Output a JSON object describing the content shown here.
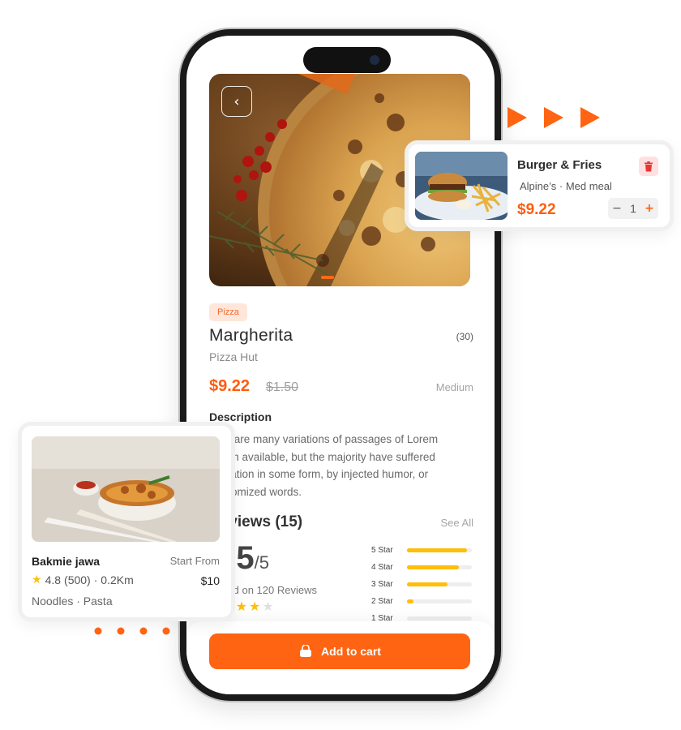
{
  "product": {
    "tag": "Pizza",
    "name": "Margherita",
    "count": "(30)",
    "brand": "Pizza Hut",
    "price": "$9.22",
    "old_price": "$1.50",
    "size": "Medium",
    "description_title": "Description",
    "description": "here are many variations of passages of Lorem Ipsum available, but the majority have suffered alteration in some form, by injected humor, or randomized words."
  },
  "reviews": {
    "title": "Reviews (15)",
    "see_all": "See All",
    "rating": "4.5",
    "rating_max": "/5",
    "based_on": "Based on 120 Reviews",
    "stars_filled": 4,
    "stars_total": 5,
    "breakdown": [
      {
        "label": "5 Star",
        "fraction": 0.93
      },
      {
        "label": "4 Star",
        "fraction": 0.8
      },
      {
        "label": "3 Star",
        "fraction": 0.62
      },
      {
        "label": "2 Star",
        "fraction": 0.1
      },
      {
        "label": "1 Star",
        "fraction": 0.0
      }
    ]
  },
  "cart": {
    "label": "Add to cart",
    "icon": "shopping-bag-icon"
  },
  "burger_card": {
    "name": "Burger & Fries",
    "meta": "Alpine’s · Med meal",
    "price": "$9.22",
    "quantity": "1",
    "minus": "−",
    "plus": "+"
  },
  "bakmie_card": {
    "name": "Bakmie jawa",
    "start_from": "Start From",
    "rating": "4.8",
    "reviews": "(500)",
    "distance": "· 0.2Km",
    "price": "$10",
    "categories": "Noodles · Pasta"
  },
  "colors": {
    "accent": "#ff6412",
    "star": "#ffbe0b",
    "tag_bg": "#ffe6da"
  }
}
